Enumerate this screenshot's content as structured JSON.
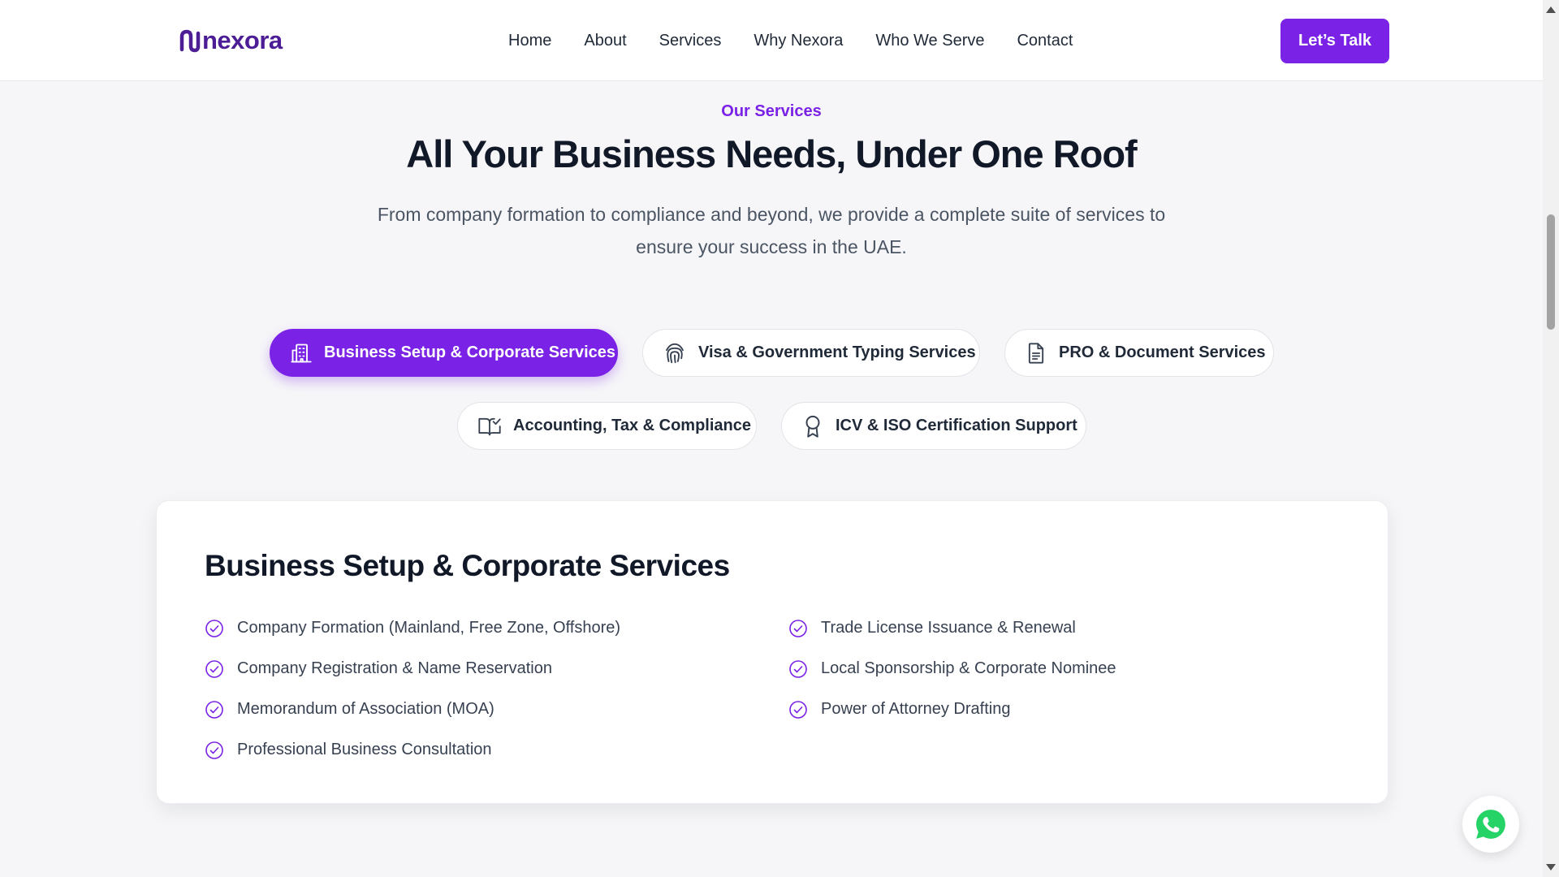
{
  "header": {
    "logo_text": "nexora",
    "nav": [
      "Home",
      "About",
      "Services",
      "Why Nexora",
      "Who We Serve",
      "Contact"
    ],
    "cta_label": "Let’s Talk"
  },
  "hero": {
    "eyebrow": "Our Services",
    "title": "All Your Business Needs, Under One Roof",
    "subtitle": "From company formation to compliance and beyond, we provide a complete suite of services to ensure your success in the UAE."
  },
  "tabs": [
    {
      "label": "Business Setup & Corporate Services",
      "icon": "building-icon",
      "active": true
    },
    {
      "label": "Visa & Government Typing Services",
      "icon": "fingerprint-icon",
      "active": false
    },
    {
      "label": "PRO & Document Services",
      "icon": "document-icon",
      "active": false
    },
    {
      "label": "Accounting, Tax & Compliance",
      "icon": "book-check-icon",
      "active": false
    },
    {
      "label": "ICV & ISO Certification Support",
      "icon": "award-icon",
      "active": false
    }
  ],
  "panel": {
    "title": "Business Setup & Corporate Services",
    "left_items": [
      "Company Formation (Mainland, Free Zone, Offshore)",
      "Company Registration & Name Reservation",
      "Memorandum of Association (MOA)",
      "Professional Business Consultation"
    ],
    "right_items": [
      "Trade License Issuance & Renewal",
      "Local Sponsorship & Corporate Nominee",
      "Power of Attorney Drafting"
    ]
  },
  "colors": {
    "accent": "#7a22e6",
    "logo": "#4c1d95",
    "whatsapp": "#25d366",
    "page_bg": "#f6f6f8"
  },
  "floating": {
    "icon": "whatsapp-icon"
  }
}
